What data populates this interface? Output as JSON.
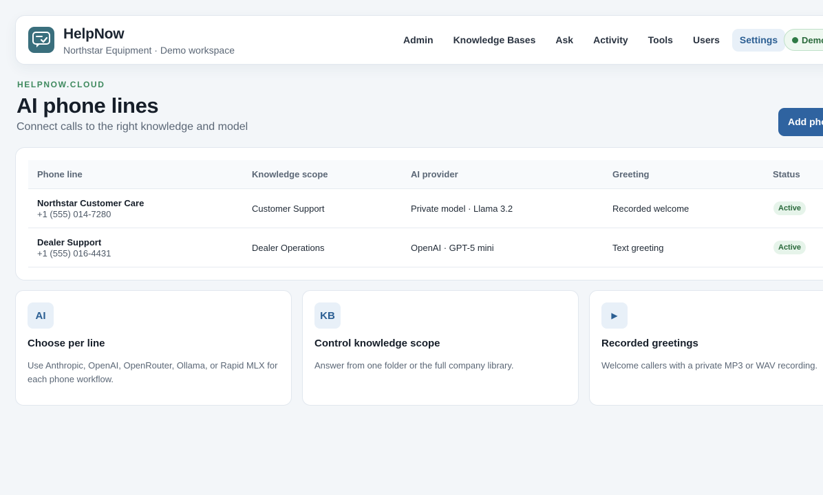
{
  "brand": {
    "name": "HelpNow",
    "subtitle": "Northstar Equipment · Demo workspace"
  },
  "nav": {
    "items": [
      "Admin",
      "Knowledge Bases",
      "Ask",
      "Activity",
      "Tools",
      "Users",
      "Settings"
    ],
    "active": "Settings",
    "demo_badge": "Demo"
  },
  "page": {
    "eyebrow": "HELPNOW.CLOUD",
    "title": "AI phone lines",
    "subtitle": "Connect calls to the right knowledge and model",
    "add_button": "Add phone line"
  },
  "table": {
    "columns": [
      "Phone line",
      "Knowledge scope",
      "AI provider",
      "Greeting",
      "Status"
    ],
    "rows": [
      {
        "name": "Northstar Customer Care",
        "number": "+1 (555) 014-7280",
        "scope": "Customer Support",
        "provider": "Private model · Llama 3.2",
        "greeting": "Recorded welcome",
        "status": "Active"
      },
      {
        "name": "Dealer Support",
        "number": "+1 (555) 016-4431",
        "scope": "Dealer Operations",
        "provider": "OpenAI · GPT-5 mini",
        "greeting": "Text greeting",
        "status": "Active"
      }
    ]
  },
  "features": [
    {
      "icon_label": "AI",
      "title": "Choose per line",
      "description": "Use Anthropic, OpenAI, OpenRouter, Ollama, or Rapid MLX for each phone workflow."
    },
    {
      "icon_label": "KB",
      "title": "Control knowledge scope",
      "description": "Answer from one folder or the full company library."
    },
    {
      "icon_label": "▶",
      "title": "Recorded greetings",
      "description": "Welcome callers with a private MP3 or WAV recording."
    }
  ],
  "colors": {
    "accent": "#2f63a0",
    "brand_logo": "#3a6f7d",
    "eyebrow": "#3f8a5f",
    "status_active": "#2b6a3c"
  }
}
